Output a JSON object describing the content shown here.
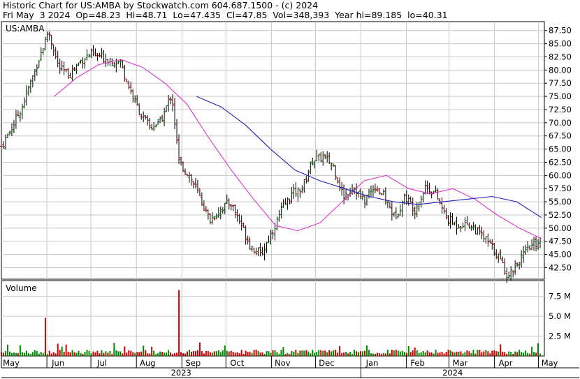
{
  "header": {
    "line1": "Historic Chart for US:AMBA by Stockwatch.com 604.687.1500 - (c) 2024",
    "line2": "Fri May  3 2024  Op=48.23  Hi=48.71  Lo=47.435  Cl=47.85  Vol=348,393  Year hi=89.185  lo=40.31"
  },
  "chart_data": [
    {
      "type": "ohlc",
      "title": "US:AMBA",
      "ylim": [
        40.31,
        89.185
      ],
      "yticks": [
        "87.50",
        "85.00",
        "82.50",
        "80.00",
        "77.50",
        "75.00",
        "72.50",
        "70.00",
        "67.50",
        "65.00",
        "62.50",
        "60.00",
        "57.50",
        "55.00",
        "52.50",
        "50.00",
        "47.50",
        "45.00",
        "42.50"
      ],
      "months": [
        "May",
        "Jun",
        "Jul",
        "Aug",
        "Sep",
        "Oct",
        "Nov",
        "Dec",
        "Jan",
        "Feb",
        "Mar",
        "Apr",
        "May"
      ],
      "years": [
        "2023",
        "2024"
      ],
      "close_approx": [
        [
          "2023-05-01",
          65.5
        ],
        [
          "2023-05-08",
          69.0
        ],
        [
          "2023-05-15",
          73.0
        ],
        [
          "2023-05-22",
          78.5
        ],
        [
          "2023-05-29",
          84.0
        ],
        [
          "2023-06-02",
          87.5
        ],
        [
          "2023-06-09",
          80.5
        ],
        [
          "2023-06-16",
          79.0
        ],
        [
          "2023-06-23",
          81.5
        ],
        [
          "2023-06-30",
          83.0
        ],
        [
          "2023-07-07",
          82.5
        ],
        [
          "2023-07-14",
          82.0
        ],
        [
          "2023-07-21",
          81.5
        ],
        [
          "2023-07-28",
          76.0
        ],
        [
          "2023-08-04",
          71.5
        ],
        [
          "2023-08-11",
          69.0
        ],
        [
          "2023-08-18",
          70.5
        ],
        [
          "2023-08-25",
          75.5
        ],
        [
          "2023-08-30",
          62.5
        ],
        [
          "2023-09-06",
          60.0
        ],
        [
          "2023-09-13",
          56.0
        ],
        [
          "2023-09-20",
          51.5
        ],
        [
          "2023-09-27",
          53.5
        ],
        [
          "2023-10-04",
          55.0
        ],
        [
          "2023-10-11",
          51.0
        ],
        [
          "2023-10-18",
          46.5
        ],
        [
          "2023-10-25",
          45.0
        ],
        [
          "2023-11-01",
          49.0
        ],
        [
          "2023-11-08",
          53.5
        ],
        [
          "2023-11-15",
          56.5
        ],
        [
          "2023-11-22",
          57.5
        ],
        [
          "2023-11-29",
          63.0
        ],
        [
          "2023-12-06",
          63.5
        ],
        [
          "2023-12-13",
          62.0
        ],
        [
          "2023-12-20",
          56.0
        ],
        [
          "2023-12-27",
          58.0
        ],
        [
          "2024-01-03",
          55.0
        ],
        [
          "2024-01-10",
          58.0
        ],
        [
          "2024-01-17",
          56.0
        ],
        [
          "2024-01-24",
          52.0
        ],
        [
          "2024-01-31",
          56.0
        ],
        [
          "2024-02-07",
          53.5
        ],
        [
          "2024-02-14",
          58.0
        ],
        [
          "2024-02-21",
          56.5
        ],
        [
          "2024-02-28",
          52.0
        ],
        [
          "2024-03-06",
          50.5
        ],
        [
          "2024-03-13",
          51.0
        ],
        [
          "2024-03-20",
          49.5
        ],
        [
          "2024-03-27",
          47.5
        ],
        [
          "2024-04-03",
          45.0
        ],
        [
          "2024-04-10",
          41.0
        ],
        [
          "2024-04-17",
          43.5
        ],
        [
          "2024-04-24",
          46.0
        ],
        [
          "2024-05-03",
          47.85
        ]
      ],
      "moving_averages": [
        {
          "color": "#dd33cc",
          "values": [
            75.0,
            78.5,
            81.0,
            82.0,
            80.5,
            77.5,
            73.5,
            67.0,
            61.0,
            55.5,
            50.5,
            49.5,
            51.0,
            55.0,
            59.0,
            60.0,
            57.5,
            56.5,
            57.5,
            55.5,
            52.5,
            50.0,
            48.0
          ]
        },
        {
          "color": "#2222bb",
          "values": [
            75.0,
            73.0,
            69.5,
            65.0,
            61.0,
            59.0,
            57.5,
            56.0,
            55.0,
            54.5,
            55.0,
            55.5,
            56.0,
            55.0,
            52.0
          ]
        }
      ]
    },
    {
      "type": "bar",
      "title": "Volume",
      "ylim": [
        0,
        9.5
      ],
      "yticks": [
        "7.5 M",
        "5.0 M",
        "2.5 M"
      ],
      "peaks_millions": [
        [
          "2023-05-31",
          4.8
        ],
        [
          "2023-08-30",
          8.3
        ]
      ],
      "typical_millions": 0.5
    }
  ],
  "colors": {
    "up": "#008800",
    "down": "#cc0000",
    "ma_short": "#dd33cc",
    "ma_long": "#2222bb",
    "grid": "#c8c8c8"
  }
}
